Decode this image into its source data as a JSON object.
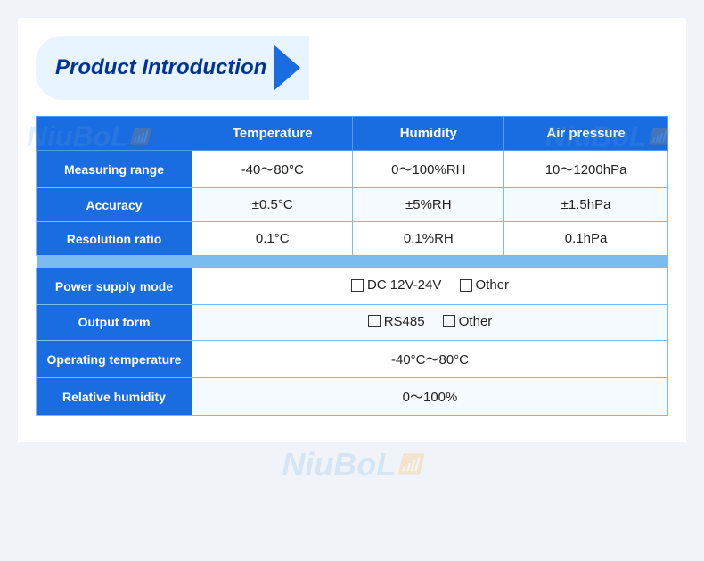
{
  "title": "Product Introduction",
  "watermarks": [
    "NiuBoL",
    "NiuBoL",
    "NiuBoL"
  ],
  "table": {
    "headers": [
      "",
      "Temperature",
      "Humidity",
      "Air pressure"
    ],
    "rows": [
      {
        "label": "Measuring range",
        "temperature": "-40～80°C",
        "humidity": "0～100%RH",
        "air_pressure": "10～1200hPa"
      },
      {
        "label": "Accuracy",
        "temperature": "±0.5°C",
        "humidity": "±5%RH",
        "air_pressure": "±1.5hPa"
      },
      {
        "label": "Resolution ratio",
        "temperature": "0.1°C",
        "humidity": "0.1%RH",
        "air_pressure": "0.1hPa"
      }
    ],
    "wide_rows": [
      {
        "label": "Power supply mode",
        "options": [
          {
            "checkbox": true,
            "text": "DC 12V-24V"
          },
          {
            "checkbox": true,
            "text": "Other"
          }
        ]
      },
      {
        "label": "Output form",
        "options": [
          {
            "checkbox": true,
            "text": "RS485"
          },
          {
            "checkbox": true,
            "text": "Other"
          }
        ]
      },
      {
        "label": "Operating temperature",
        "value": "-40°C～80°C"
      },
      {
        "label": "Relative humidity",
        "value": "0～100%"
      }
    ]
  }
}
